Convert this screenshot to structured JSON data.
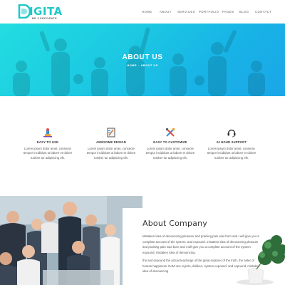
{
  "brand": {
    "logo_text": "IGITA",
    "logo_sub": "BE CORPORATE",
    "accent": "#1fc8c8"
  },
  "nav": {
    "items": [
      "HOME",
      "ABOUT",
      "SERVICES",
      "PORTFOLIO",
      "PAGES",
      "BLOG",
      "CONTACT"
    ]
  },
  "hero": {
    "title": "ABOUT US",
    "crumb_home": "HOME",
    "crumb_sep": "·",
    "crumb_current": "ABOUT US",
    "gradient_start": "#22dde0",
    "gradient_end": "#1aa6e8"
  },
  "features": [
    {
      "icon": "easy-to-use-icon",
      "title": "EASY TO USE",
      "line1": "Lorem ipsum dolor amet, consecte",
      "line2": "tempor incididunt ut labore et dolore",
      "line3": "tumber tur adipiscing elit."
    },
    {
      "icon": "design-icon",
      "title": "AWESOME DESIGN",
      "line1": "Lorem ipsum dolor amet, consecte",
      "line2": "tempor incididunt ut labore et dolore",
      "line3": "tumber tur adipiscing elit."
    },
    {
      "icon": "tools-icon",
      "title": "EASY TO CUSTOMIZE",
      "line1": "Lorem ipsum dolor amet, consecte",
      "line2": "tempor incididunt ut labore et dolore",
      "line3": "tumber tur adipiscing elit."
    },
    {
      "icon": "headset-icon",
      "title": "24 HOUR SUPPORT",
      "line1": "Lorem ipsum dolor amet, consecte",
      "line2": "tempor incididunt ut labore et dolore",
      "line3": "tumber tur adipiscing elit."
    }
  ],
  "about": {
    "title": "About Company",
    "p1": "Mistaken idea of denouncing pleasure and praising pain was born and I will give you a complete account of the system, and expound. mistaken idea of denouncing pleasure and praising pain was born and I will give you a complete account of the system expound. mistaken idea of denouncing.",
    "p2": "the and expound the actual teachings of the great explorer of the truth, the aster of human happiness. NoM one rejects, dislikes, system expound. and expound, mistaken idea of denouncing"
  }
}
